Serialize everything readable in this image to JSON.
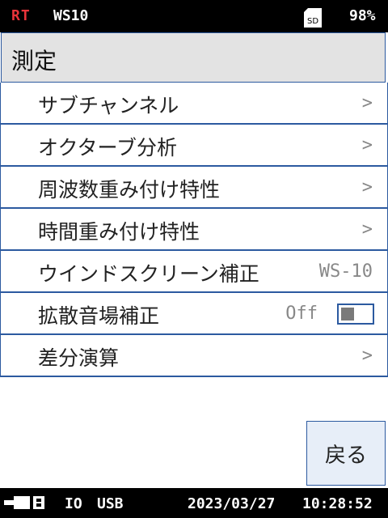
{
  "status": {
    "mode": "RT",
    "model": "WS10",
    "sd_label": "SD",
    "battery": "98%"
  },
  "title": "測定",
  "menu": [
    {
      "label": "サブチャンネル",
      "chevron": ">"
    },
    {
      "label": "オクターブ分析",
      "chevron": ">"
    },
    {
      "label": "周波数重み付け特性",
      "chevron": ">"
    },
    {
      "label": "時間重み付け特性",
      "chevron": ">"
    },
    {
      "label": "ウインドスクリーン補正",
      "value": "WS-10"
    },
    {
      "label": "拡散音場補正",
      "value": "Off",
      "toggle_on": false
    }
  ],
  "menu_last": {
    "label": "差分演算",
    "chevron": ">"
  },
  "back_button": "戻る",
  "footer": {
    "io": "IO",
    "usb": "USB",
    "date": "2023/03/27",
    "time": "10:28:52"
  },
  "colors": {
    "accent": "#2c5aa0",
    "mode": "#e8343a"
  }
}
